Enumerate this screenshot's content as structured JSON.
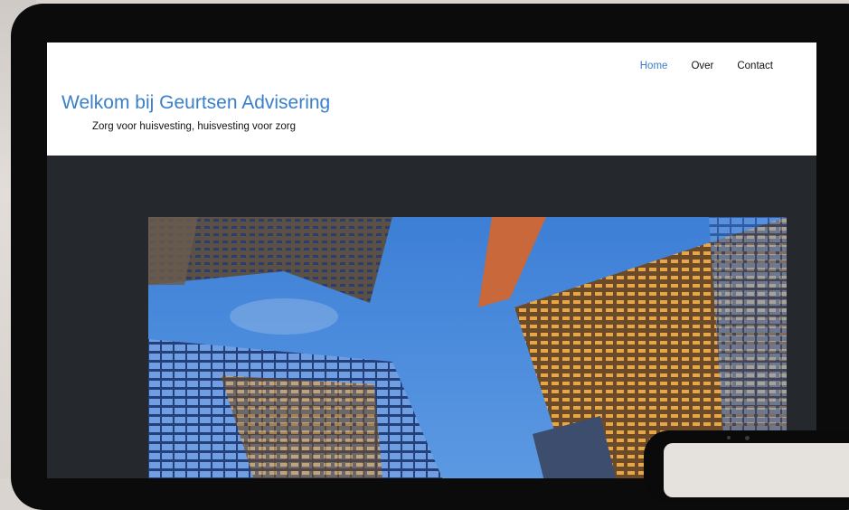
{
  "nav": {
    "items": [
      {
        "label": "Home",
        "active": true
      },
      {
        "label": "Over",
        "active": false
      },
      {
        "label": "Contact",
        "active": false
      }
    ]
  },
  "site": {
    "title": "Welkom bij Geurtsen Advisering",
    "subtitle": "Zorg voor huisvesting, huisvesting voor zorg"
  },
  "colors": {
    "accent": "#3a7fc9",
    "header_bg": "#ffffff",
    "hero_bg": "#25282d",
    "device_frame": "#0b0b0b"
  }
}
